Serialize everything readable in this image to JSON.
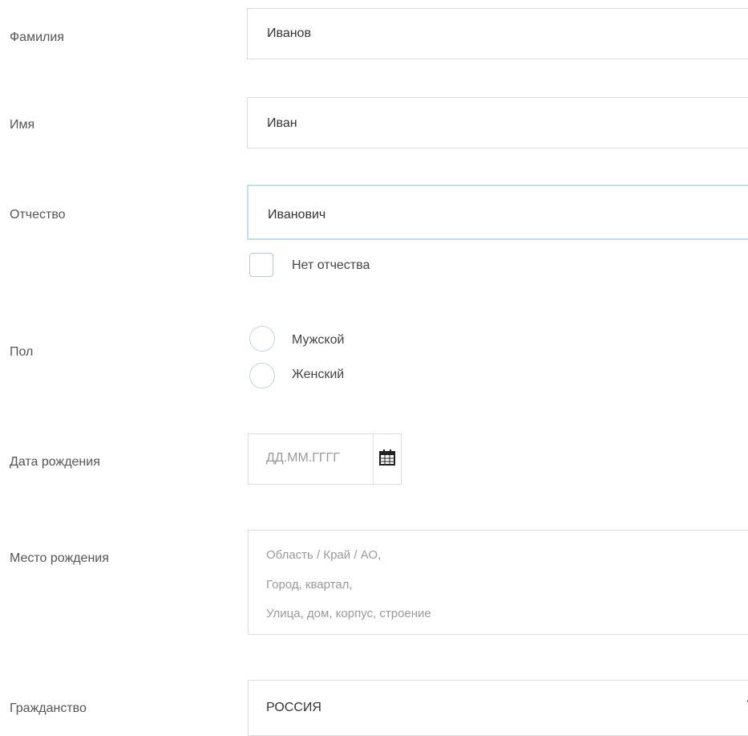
{
  "form": {
    "last_name": {
      "label": "Фамилия",
      "value": "Иванов"
    },
    "first_name": {
      "label": "Имя",
      "value": "Иван"
    },
    "patronymic": {
      "label": "Отчество",
      "value": "Иванович",
      "no_patronymic_label": "Нет отчества"
    },
    "gender": {
      "label": "Пол",
      "options": [
        "Мужской",
        "Женский"
      ]
    },
    "birth_date": {
      "label": "Дата рождения",
      "placeholder": "ДД.ММ.ГГГГ"
    },
    "birth_place": {
      "label": "Место рождения",
      "placeholder_lines": [
        "Область / Край / АО,",
        "Город, квартал,",
        "Улица, дом, корпус, строение"
      ]
    },
    "citizenship": {
      "label": "Гражданство",
      "value": "РОССИЯ"
    }
  },
  "icons": {
    "calendar": "calendar-icon",
    "dropdown": "chevron-down-icon"
  },
  "colors": {
    "border": "#dcdcdc",
    "focus_border": "#c6dbe8",
    "label_text": "#555555",
    "placeholder_text": "#9a9a9a"
  }
}
